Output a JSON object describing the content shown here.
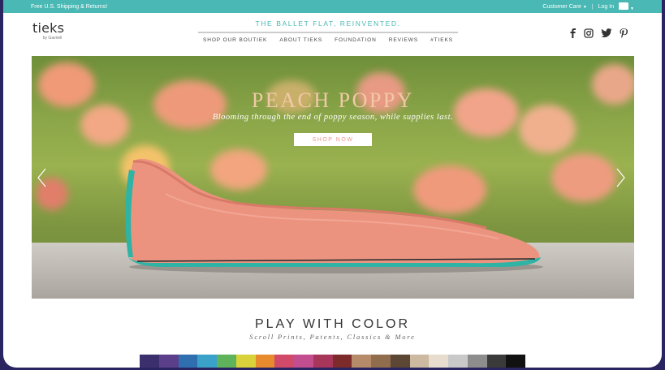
{
  "topbar": {
    "shipping_text": "Free U.S. Shipping & Returns!",
    "customer_care_label": "Customer Care",
    "login_label": "Log In",
    "separator": "|",
    "background_color": "#4ab8b4"
  },
  "header": {
    "logo_text": "tieks",
    "logo_byline": "by Gavrieli",
    "tagline": "THE BALLET FLAT, REINVENTED.",
    "nav": [
      {
        "label": "SHOP OUR BOUTIEK"
      },
      {
        "label": "ABOUT TIEKS"
      },
      {
        "label": "FOUNDATION"
      },
      {
        "label": "REVIEWS"
      },
      {
        "label": "#TIEKS"
      }
    ],
    "social_icons": [
      "facebook-icon",
      "instagram-icon",
      "twitter-icon",
      "pinterest-icon"
    ]
  },
  "hero": {
    "title": "PEACH POPPY",
    "subtitle": "Blooming through the end of poppy season, while supplies last.",
    "button_label": "SHOP NOW",
    "prev_icon": "chevron-left-icon",
    "next_icon": "chevron-right-icon",
    "title_color": "#f2c9a6",
    "button_text_color": "#e8988a",
    "shoe_color": "#ec9380",
    "sole_color": "#2eb3a5"
  },
  "section": {
    "title": "PLAY WITH COLOR",
    "subtitle": "Scroll Prints, Patents, Classics & More",
    "swatch_colors": [
      "#3b2f6e",
      "#5b3f8a",
      "#2f6fb0",
      "#3aa1c9",
      "#5fb35a",
      "#d9d23a",
      "#e88b2e",
      "#d24a6a",
      "#c24d8f",
      "#a8355a",
      "#7c2a2a",
      "#b58b6a",
      "#8f6d4d",
      "#5c4634",
      "#cdb9a0",
      "#e7dccd",
      "#c9c9c9",
      "#8d8d8d",
      "#3a3a3a",
      "#111111"
    ]
  }
}
